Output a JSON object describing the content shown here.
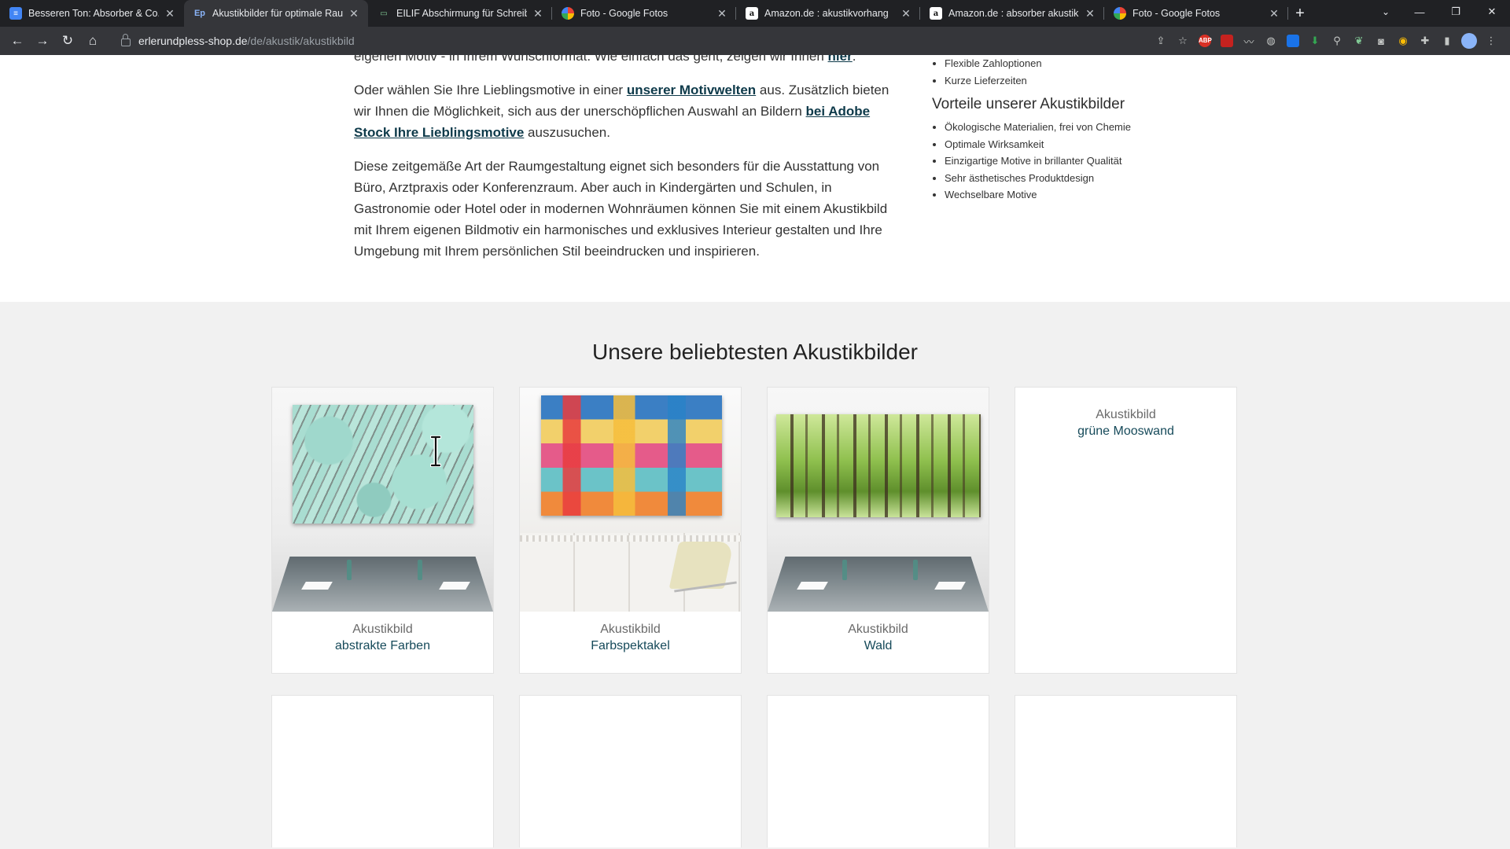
{
  "browser": {
    "tabs": [
      {
        "title": "Besseren Ton: Absorber & Co. -",
        "icon": "docs-icon",
        "active": false
      },
      {
        "title": "Akustikbilder für optimale Raum",
        "icon": "ep-icon",
        "active": true
      },
      {
        "title": "EILIF Abschirmung für Schreibtis",
        "icon": "elif-icon",
        "active": false
      },
      {
        "title": "Foto - Google Fotos",
        "icon": "google-photos-icon",
        "active": false
      },
      {
        "title": "Amazon.de : akustikvorhang",
        "icon": "amazon-icon",
        "active": false
      },
      {
        "title": "Amazon.de : absorber akustik",
        "icon": "amazon-icon",
        "active": false
      },
      {
        "title": "Foto - Google Fotos",
        "icon": "google-photos-icon",
        "active": false
      }
    ],
    "url_host": "erlerundpless-shop.de",
    "url_path": "/de/akustik/akustikbild"
  },
  "intro": {
    "p0_text": "eigenen Motiv - in Ihrem Wunschformat. Wie einfach das geht, zeigen wir Ihnen ",
    "p0_link": "hier",
    "p0_end": ".",
    "p1_a": "Oder wählen Sie Ihre Lieblingsmotive in einer ",
    "p1_link1": "unserer Motivwelten",
    "p1_b": " aus. Zusätzlich bieten wir Ihnen die Möglichkeit, sich aus der unerschöpflichen Auswahl an Bildern ",
    "p1_link2": "bei Adobe Stock Ihre Lieblingsmotive",
    "p1_c": " auszusuchen.",
    "p2": "Diese zeitgemäße Art der Raumgestaltung eignet sich besonders für die Ausstattung von Büro, Arztpraxis oder Konferenzraum. Aber auch in Kindergärten und Schulen, in Gastronomie oder Hotel oder in modernen Wohnräumen können Sie mit einem Akustikbild mit Ihrem eigenen Bildmotiv ein harmonisches und exklusives Interieur gestalten und Ihre Umgebung mit Ihrem persönlichen Stil beeindrucken und inspirieren."
  },
  "aside": {
    "top_items": [
      "Flexible Zahloptionen",
      "Kurze Lieferzeiten"
    ],
    "heading": "Vorteile unserer Akustikbilder",
    "items": [
      "Ökologische Materialien, frei von Chemie",
      "Optimale Wirksamkeit",
      "Einzigartige Motive in brillanter Qualität",
      "Sehr ästhetisches Produktdesign",
      "Wechselbare Motive"
    ]
  },
  "section": {
    "title": "Unsere beliebtesten Akustikbilder"
  },
  "products": [
    {
      "line1": "Akustikbild",
      "line2": "abstrakte Farben"
    },
    {
      "line1": "Akustikbild",
      "line2": "Farbspektakel"
    },
    {
      "line1": "Akustikbild",
      "line2": "Wald"
    },
    {
      "line1": "Akustikbild",
      "line2": "grüne Mooswand"
    }
  ]
}
